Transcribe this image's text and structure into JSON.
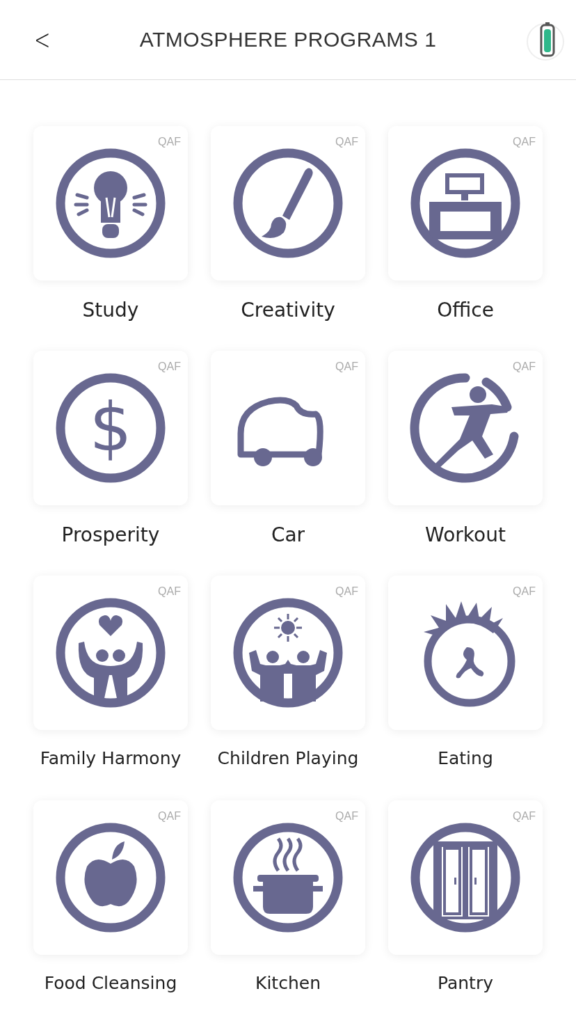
{
  "header": {
    "back": "<",
    "title": "ATMOSPHERE PROGRAMS 1"
  },
  "programs": [
    {
      "label": "Study",
      "tag": "QAF"
    },
    {
      "label": "Creativity",
      "tag": "QAF"
    },
    {
      "label": "Office",
      "tag": "QAF"
    },
    {
      "label": "Prosperity",
      "tag": "QAF",
      "symbol": "$"
    },
    {
      "label": "Car",
      "tag": "QAF"
    },
    {
      "label": "Workout",
      "tag": "QAF"
    },
    {
      "label": "Family Harmony",
      "tag": "QAF"
    },
    {
      "label": "Children Playing",
      "tag": "QAF"
    },
    {
      "label": "Eating",
      "tag": "QAF"
    },
    {
      "label": "Food Cleansing",
      "tag": "QAF"
    },
    {
      "label": "Kitchen",
      "tag": "QAF"
    },
    {
      "label": "Pantry",
      "tag": "QAF"
    }
  ]
}
